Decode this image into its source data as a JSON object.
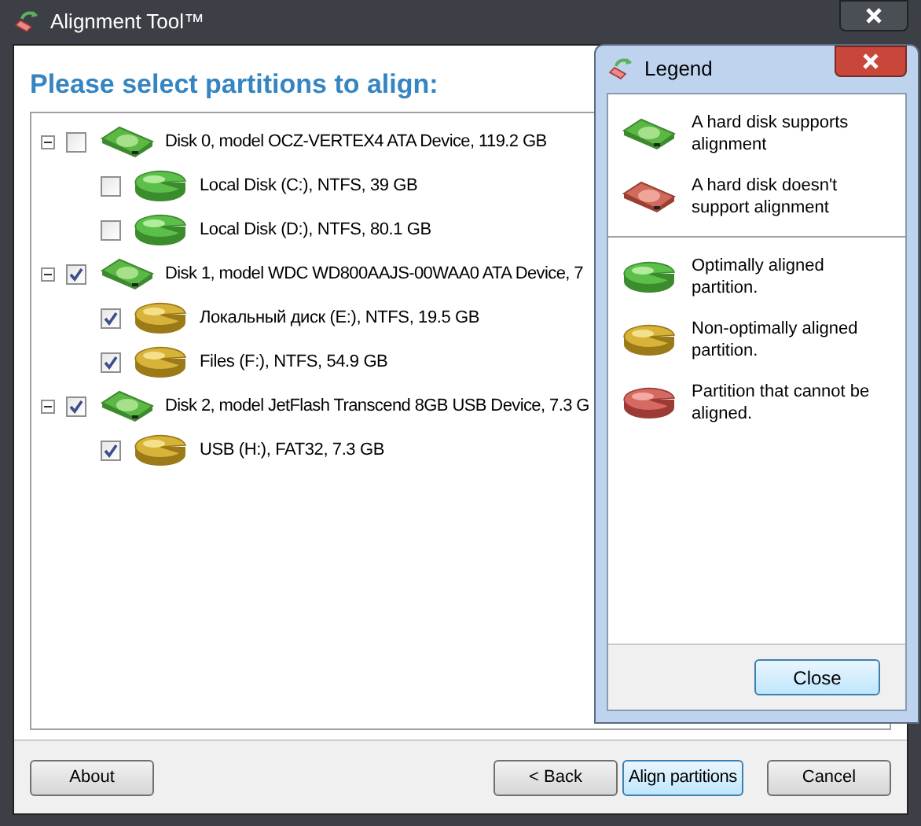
{
  "window": {
    "title": "Alignment Tool™"
  },
  "heading": "Please select partitions to align:",
  "disks": [
    {
      "label": "Disk 0, model OCZ-VERTEX4 ATA Device, 119.2 GB",
      "expanded": true,
      "checked": false,
      "kind": "disk_supported",
      "partitions": [
        {
          "label": "Local Disk (C:), NTFS, 39 GB",
          "checked": false,
          "kind": "optimal"
        },
        {
          "label": "Local Disk (D:), NTFS, 80.1 GB",
          "checked": false,
          "kind": "optimal"
        }
      ]
    },
    {
      "label": "Disk 1, model WDC WD800AAJS-00WAA0 ATA Device, 7",
      "expanded": true,
      "checked": true,
      "kind": "disk_supported",
      "partitions": [
        {
          "label": "Локальный диск (E:), NTFS, 19.5 GB",
          "checked": true,
          "kind": "non_optimal"
        },
        {
          "label": "Files (F:), NTFS, 54.9 GB",
          "checked": true,
          "kind": "non_optimal"
        }
      ]
    },
    {
      "label": "Disk 2, model JetFlash Transcend 8GB USB Device, 7.3 G",
      "expanded": true,
      "checked": true,
      "kind": "disk_supported",
      "partitions": [
        {
          "label": "USB (H:), FAT32, 7.3 GB",
          "checked": true,
          "kind": "non_optimal"
        }
      ]
    }
  ],
  "footer_buttons": [
    {
      "label": "About",
      "default": false
    },
    {
      "label": "< Back",
      "default": false
    },
    {
      "label": "Align partitions",
      "default": true
    },
    {
      "label": "Cancel",
      "default": false
    }
  ],
  "legend": {
    "title": "Legend",
    "groups": [
      [
        {
          "kind": "disk_supported",
          "text": "A hard disk supports alignment"
        },
        {
          "kind": "disk_unsupported",
          "text": "A hard disk doesn't support alignment"
        }
      ],
      [
        {
          "kind": "optimal",
          "text": "Optimally aligned partition."
        },
        {
          "kind": "non_optimal",
          "text": "Non-optimally aligned partition."
        },
        {
          "kind": "unaligned",
          "text": "Partition that cannot be aligned."
        }
      ]
    ],
    "close_button": "Close"
  }
}
